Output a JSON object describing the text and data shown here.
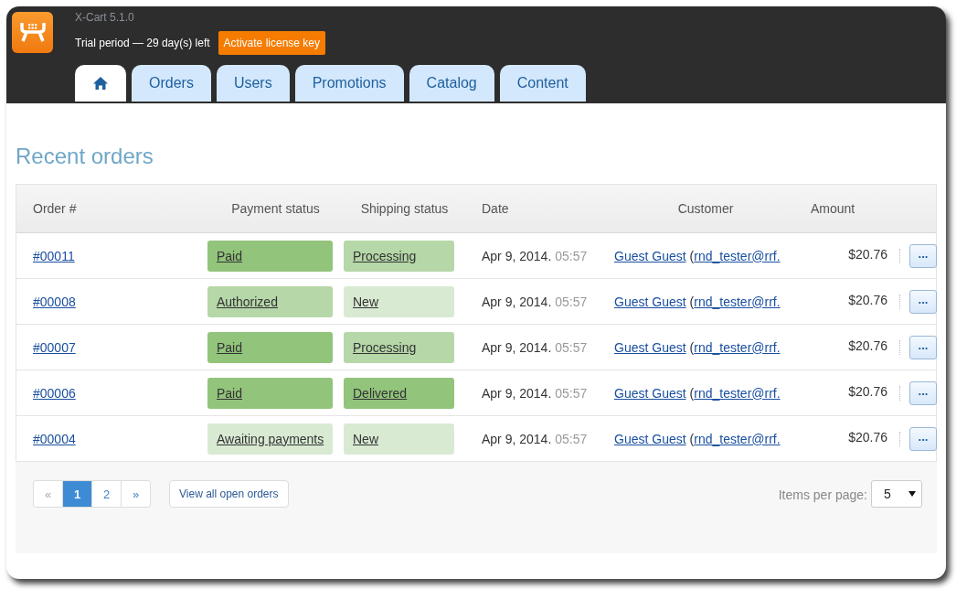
{
  "header": {
    "version": "X-Cart 5.1.0",
    "trial": "Trial period — 29 day(s) left",
    "activate_button": "Activate license key"
  },
  "tabs": [
    {
      "kind": "home",
      "selected": true
    },
    {
      "kind": "text",
      "label": "Orders",
      "selected": false
    },
    {
      "kind": "text",
      "label": "Users",
      "selected": false
    },
    {
      "kind": "text",
      "label": "Promotions",
      "selected": false
    },
    {
      "kind": "text",
      "label": "Catalog",
      "selected": false
    },
    {
      "kind": "text",
      "label": "Content",
      "selected": false
    }
  ],
  "title": "Recent orders",
  "table": {
    "columns": [
      "Order #",
      "Payment status",
      "Shipping status",
      "Date",
      "Customer",
      "Amount"
    ],
    "rows": [
      {
        "order": "#00011",
        "payment": {
          "label": "Paid",
          "color": "#92c47c"
        },
        "shipping": {
          "label": "Processing",
          "color": "#b6d7a8"
        },
        "date": "Apr 9, 2014.",
        "time": "05:57",
        "customer": "Guest Guest",
        "paren": "(",
        "email": "rnd_tester@rrf.",
        "amount": "$20.76",
        "menu": "..."
      },
      {
        "order": "#00008",
        "payment": {
          "label": "Authorized",
          "color": "#b6d7a8"
        },
        "shipping": {
          "label": "New",
          "color": "#d9ead3"
        },
        "date": "Apr 9, 2014.",
        "time": "05:57",
        "customer": "Guest Guest",
        "paren": "(",
        "email": "rnd_tester@rrf.",
        "amount": "$20.76",
        "menu": "..."
      },
      {
        "order": "#00007",
        "payment": {
          "label": "Paid",
          "color": "#92c47c"
        },
        "shipping": {
          "label": "Processing",
          "color": "#b6d7a8"
        },
        "date": "Apr 9, 2014.",
        "time": "05:57",
        "customer": "Guest Guest",
        "paren": "(",
        "email": "rnd_tester@rrf.",
        "amount": "$20.76",
        "menu": "..."
      },
      {
        "order": "#00006",
        "payment": {
          "label": "Paid",
          "color": "#92c47c"
        },
        "shipping": {
          "label": "Delivered",
          "color": "#92c47c"
        },
        "date": "Apr 9, 2014.",
        "time": "05:57",
        "customer": "Guest Guest",
        "paren": "(",
        "email": "rnd_tester@rrf.",
        "amount": "$20.76",
        "menu": "..."
      },
      {
        "order": "#00004",
        "payment": {
          "label": "Awaiting payments",
          "color": "#d9ead3"
        },
        "shipping": {
          "label": "New",
          "color": "#d9ead3"
        },
        "date": "Apr 9, 2014.",
        "time": "05:57",
        "customer": "Guest Guest",
        "paren": "(",
        "email": "rnd_tester@rrf.",
        "amount": "$20.76",
        "menu": "..."
      }
    ]
  },
  "pagination": [
    {
      "label": "«",
      "selected": false,
      "disabled": true
    },
    {
      "label": "1",
      "selected": true,
      "disabled": false
    },
    {
      "label": "2",
      "selected": false,
      "disabled": false
    },
    {
      "label": "»",
      "selected": false,
      "disabled": false
    }
  ],
  "view_all_button": "View all open orders",
  "items_per_page": {
    "label": "Items per page:",
    "value": "5"
  }
}
